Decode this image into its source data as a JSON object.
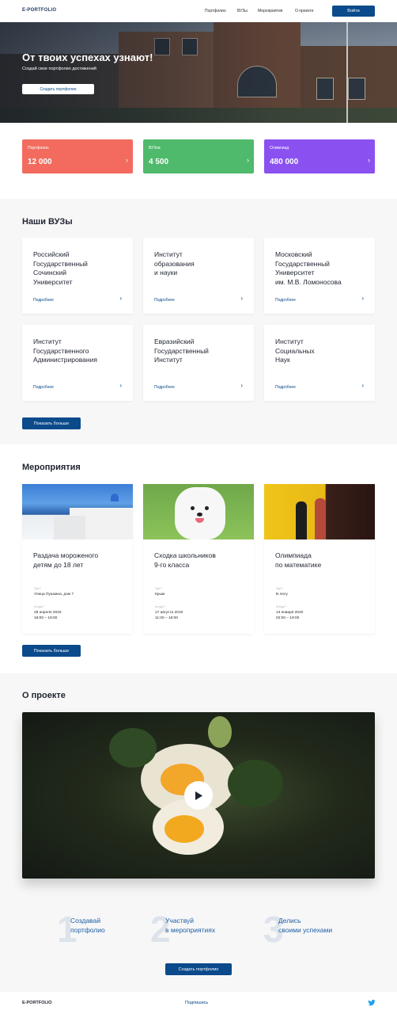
{
  "header": {
    "logo": "E-PORTFOLIO",
    "nav": [
      "Портфолио",
      "ВУЗы",
      "Мероприятия",
      "О проекте"
    ],
    "login_label": "Войти"
  },
  "hero": {
    "title": "От твоих успехах узнают!",
    "subtitle": "Создай свое портфолио достижений",
    "cta_label": "Создать портфолио"
  },
  "stats": [
    {
      "label": "Портфолио",
      "value": "12 000",
      "color": "#f26b5e"
    },
    {
      "label": "ВУЗов",
      "value": "4 500",
      "color": "#4fba6b"
    },
    {
      "label": "Олимпиад",
      "value": "480 000",
      "color": "#8a51f0"
    }
  ],
  "universities": {
    "title": "Наши ВУЗы",
    "more_label": "Подробнее",
    "show_more_label": "Показать больше",
    "items": [
      [
        "Российский",
        "Государственный",
        "Сочинский",
        "Университет"
      ],
      [
        "Институт",
        "образования",
        "и науки"
      ],
      [
        "Московский",
        "Государственный",
        "Университет",
        "им. М.В. Ломоносова"
      ],
      [
        "Институт",
        "Государственного",
        "Администрирования"
      ],
      [
        "Евразийский",
        "Государственный",
        "Институт"
      ],
      [
        "Институт",
        "Социальных",
        "Наук"
      ]
    ]
  },
  "events": {
    "title": "Мероприятия",
    "show_more_label": "Показать больше",
    "place_label": "Где?",
    "when_label": "Когда?",
    "items": [
      {
        "title": [
          "Раздача мороженого",
          "детям до 18 лет"
        ],
        "place": "Улица Пушкина, дом 7",
        "date": "28 апреля 2018",
        "time": "18:00 – 19:00"
      },
      {
        "title": [
          "Сходка школьников",
          "9-го класса"
        ],
        "place": "Крым",
        "date": "17 августа 2019",
        "time": "11:00 – 18:00"
      },
      {
        "title": [
          "Олимпиада",
          "по математике"
        ],
        "place": "В лесу",
        "date": "13 января 2020",
        "time": "02:00 – 19:00"
      }
    ]
  },
  "about": {
    "title": "О проекте",
    "steps": [
      {
        "num": "1",
        "text": [
          "Создавай",
          "портфолио"
        ]
      },
      {
        "num": "2",
        "text": [
          "Участвуй",
          "в мероприятиях"
        ]
      },
      {
        "num": "3",
        "text": [
          "Делись",
          "своими успехами"
        ]
      }
    ],
    "cta_label": "Создать портфолио"
  },
  "footer": {
    "logo": "E-PORTFOLIO",
    "subscribe_label": "Подпишись",
    "social_icon": "twitter-icon"
  }
}
